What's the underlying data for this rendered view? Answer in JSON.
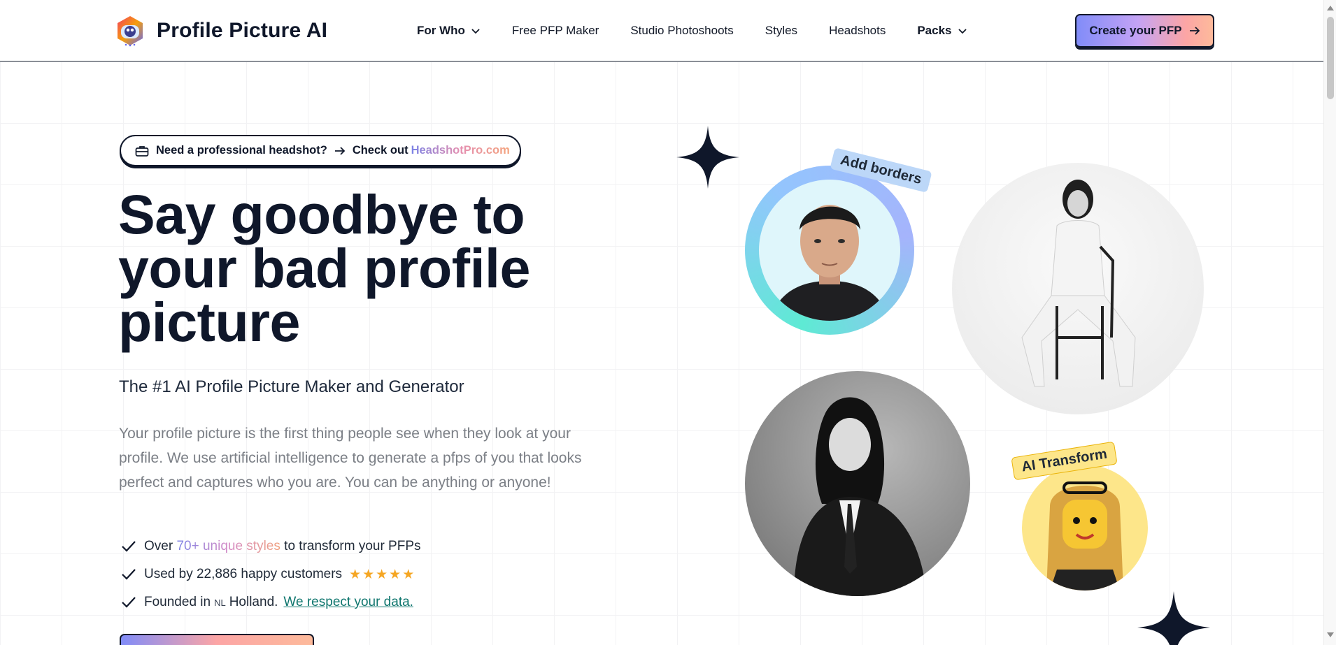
{
  "header": {
    "brand": "Profile Picture AI",
    "nav": [
      {
        "label": "For Who",
        "has_dropdown": true,
        "bold": true
      },
      {
        "label": "Free PFP Maker",
        "has_dropdown": false,
        "bold": false
      },
      {
        "label": "Studio Photoshoots",
        "has_dropdown": false,
        "bold": false
      },
      {
        "label": "Styles",
        "has_dropdown": false,
        "bold": false
      },
      {
        "label": "Headshots",
        "has_dropdown": false,
        "bold": false
      },
      {
        "label": "Packs",
        "has_dropdown": true,
        "bold": true
      }
    ],
    "cta_label": "Create your PFP"
  },
  "hero": {
    "promo": {
      "question": "Need a professional headshot?",
      "check_out": "Check out",
      "brand": "HeadshotPro.com"
    },
    "headline": "Say goodbye to your bad profile picture",
    "subhead": "The #1 AI Profile Picture Maker and Generator",
    "description": "Your profile picture is the first thing people see when they look at your profile. We use artificial intelligence to generate a pfps of you that looks perfect and captures who you are. You can be anything or anyone!",
    "checks": {
      "styles_prefix": "Over",
      "styles_highlight": "70+ unique styles",
      "styles_suffix": "to transform your PFPs",
      "customers": "Used by 22,886 happy customers",
      "rating_stars": 5,
      "founded_prefix": "Founded in",
      "founded_flag": "NL",
      "founded_country": "Holland.",
      "data_link": "We respect your data."
    }
  },
  "showcase": {
    "tag_borders": "Add borders",
    "tag_transform": "AI Transform"
  },
  "colors": {
    "ink": "#0f172a",
    "accent_start": "#818cf8",
    "accent_end": "#fdba9b",
    "link": "#0f766e",
    "star": "#f5a623"
  }
}
